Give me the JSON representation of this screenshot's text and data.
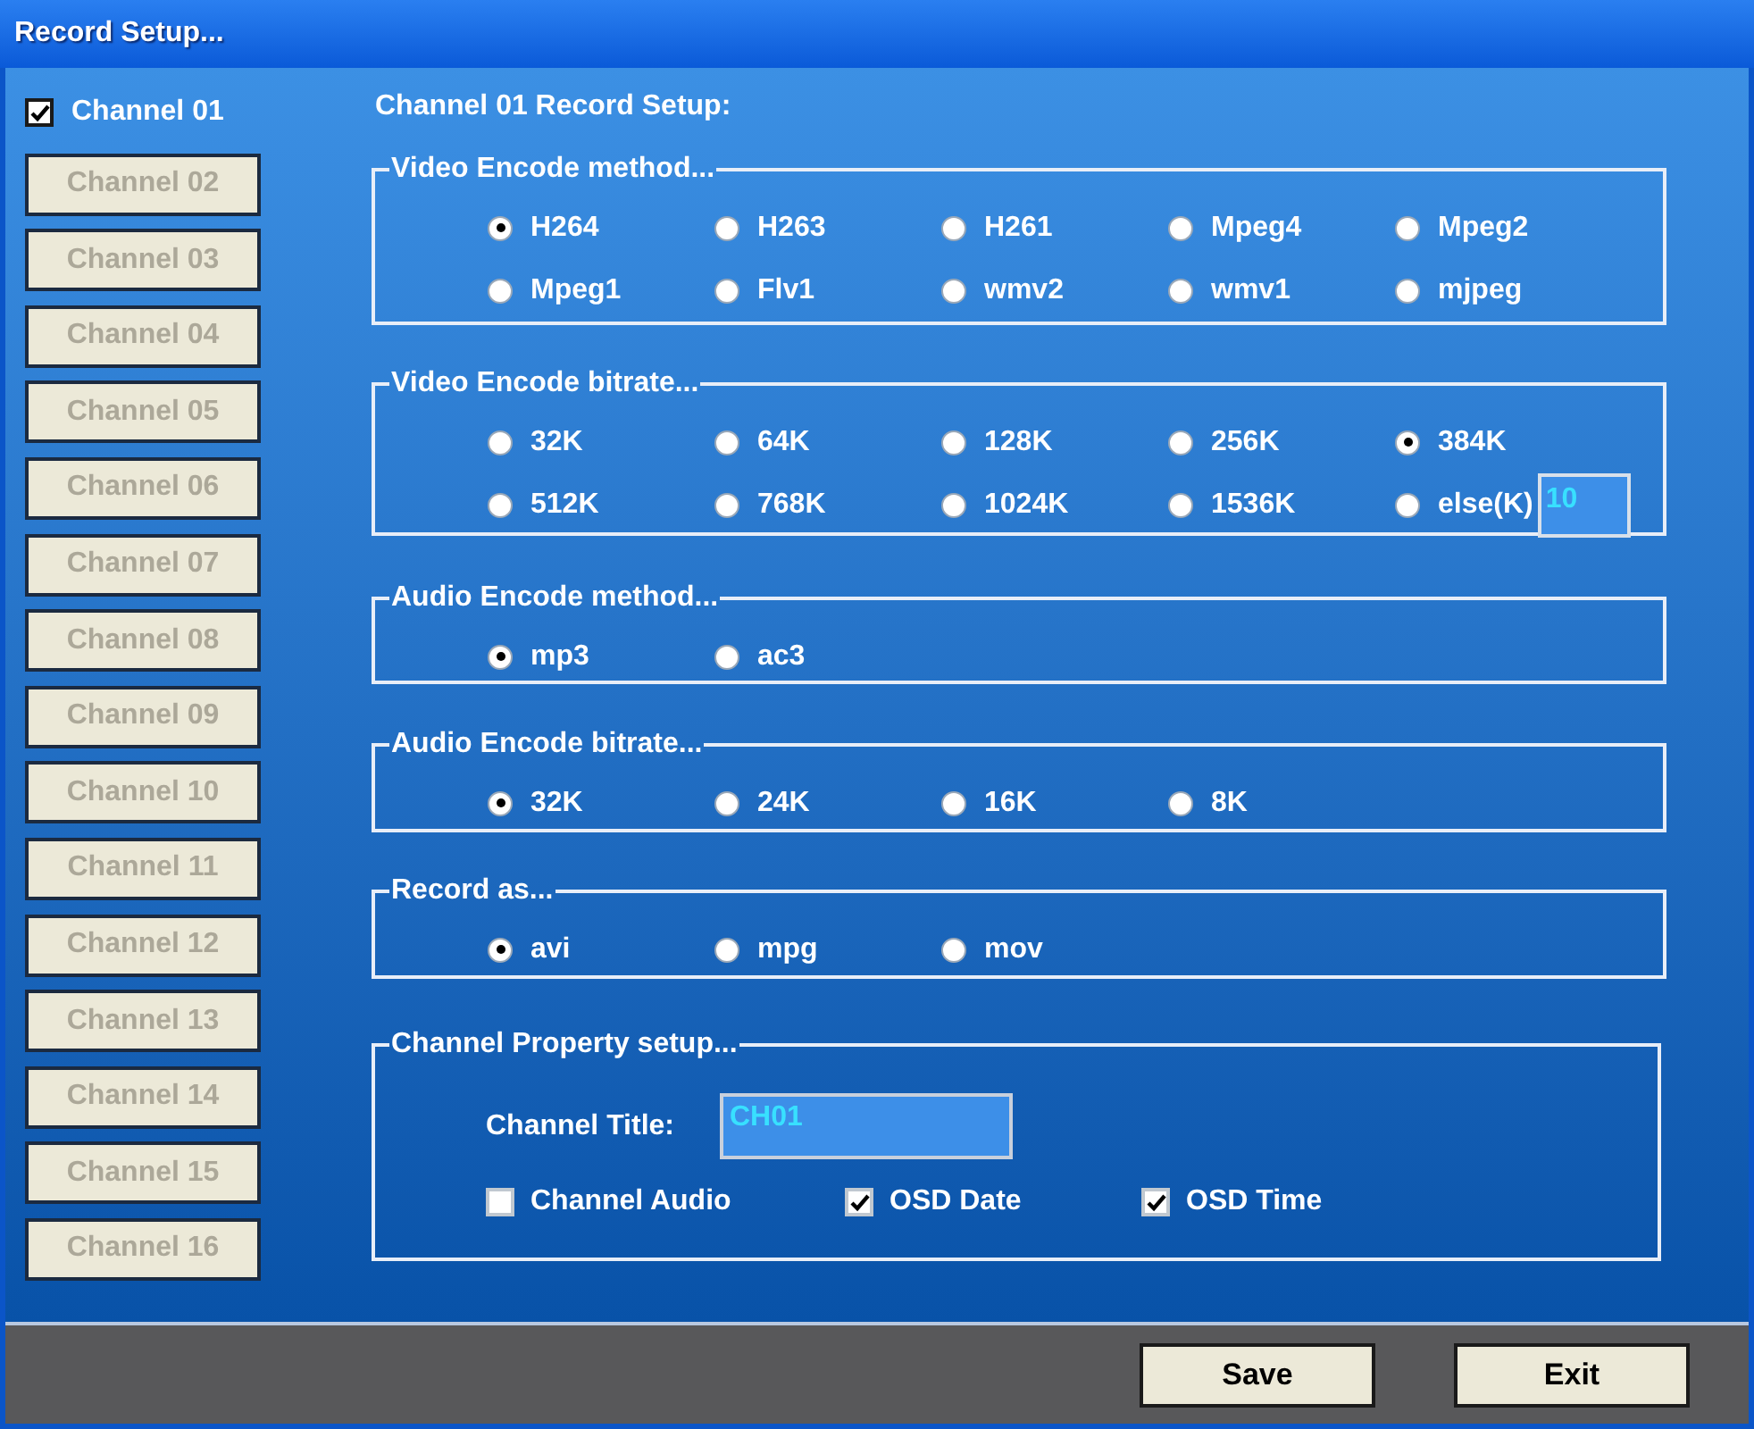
{
  "window": {
    "title": "Record Setup..."
  },
  "channels": [
    {
      "kind": "checkbox",
      "label": "Channel 01",
      "checked": true
    },
    {
      "kind": "button",
      "label": "Channel 02",
      "disabled": true
    },
    {
      "kind": "button",
      "label": "Channel 03",
      "disabled": true
    },
    {
      "kind": "button",
      "label": "Channel 04",
      "disabled": true
    },
    {
      "kind": "button",
      "label": "Channel 05",
      "disabled": true
    },
    {
      "kind": "button",
      "label": "Channel 06",
      "disabled": true
    },
    {
      "kind": "button",
      "label": "Channel 07",
      "disabled": true
    },
    {
      "kind": "button",
      "label": "Channel 08",
      "disabled": true
    },
    {
      "kind": "button",
      "label": "Channel 09",
      "disabled": true
    },
    {
      "kind": "button",
      "label": "Channel 10",
      "disabled": true
    },
    {
      "kind": "button",
      "label": "Channel 11",
      "disabled": true
    },
    {
      "kind": "button",
      "label": "Channel 12",
      "disabled": true
    },
    {
      "kind": "button",
      "label": "Channel 13",
      "disabled": true
    },
    {
      "kind": "button",
      "label": "Channel 14",
      "disabled": true
    },
    {
      "kind": "button",
      "label": "Channel 15",
      "disabled": true
    },
    {
      "kind": "button",
      "label": "Channel 16",
      "disabled": true
    }
  ],
  "heading": "Channel 01 Record Setup:",
  "groups": [
    {
      "title": "Video Encode method...",
      "options": [
        {
          "label": "H264",
          "selected": true
        },
        {
          "label": "H263",
          "selected": false
        },
        {
          "label": "H261",
          "selected": false
        },
        {
          "label": "Mpeg4",
          "selected": false
        },
        {
          "label": "Mpeg2",
          "selected": false
        },
        {
          "label": "Mpeg1",
          "selected": false
        },
        {
          "label": "Flv1",
          "selected": false
        },
        {
          "label": "wmv2",
          "selected": false
        },
        {
          "label": "wmv1",
          "selected": false
        },
        {
          "label": "mjpeg",
          "selected": false
        }
      ]
    },
    {
      "title": "Video Encode bitrate...",
      "options": [
        {
          "label": "32K",
          "selected": false
        },
        {
          "label": "64K",
          "selected": false
        },
        {
          "label": "128K",
          "selected": false
        },
        {
          "label": "256K",
          "selected": false
        },
        {
          "label": "384K",
          "selected": true
        },
        {
          "label": "512K",
          "selected": false
        },
        {
          "label": "768K",
          "selected": false
        },
        {
          "label": "1024K",
          "selected": false
        },
        {
          "label": "1536K",
          "selected": false
        },
        {
          "label": "else(K)",
          "selected": false,
          "field": {
            "value": "10"
          }
        }
      ]
    },
    {
      "title": "Audio Encode method...",
      "options": [
        {
          "label": "mp3",
          "selected": true
        },
        {
          "label": "ac3",
          "selected": false
        }
      ]
    },
    {
      "title": "Audio Encode bitrate...",
      "options": [
        {
          "label": "32K",
          "selected": true
        },
        {
          "label": "24K",
          "selected": false
        },
        {
          "label": "16K",
          "selected": false
        },
        {
          "label": "8K",
          "selected": false
        }
      ]
    },
    {
      "title": "Record as...",
      "options": [
        {
          "label": "avi",
          "selected": true
        },
        {
          "label": "mpg",
          "selected": false
        },
        {
          "label": "mov",
          "selected": false
        }
      ]
    }
  ],
  "property": {
    "title": "Channel Property setup...",
    "title_label": "Channel Title:",
    "title_value": "CH01",
    "checks": [
      {
        "label": "Channel Audio",
        "checked": false
      },
      {
        "label": "OSD Date",
        "checked": true
      },
      {
        "label": "OSD Time",
        "checked": true
      }
    ]
  },
  "buttons": [
    "Save",
    "Exit"
  ]
}
